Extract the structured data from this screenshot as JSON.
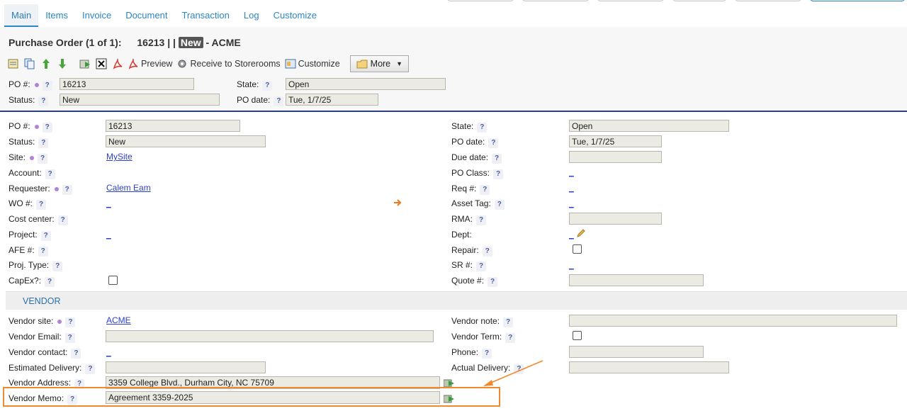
{
  "tabs": [
    {
      "label": "Main",
      "active": true
    },
    {
      "label": "Items"
    },
    {
      "label": "Invoice"
    },
    {
      "label": "Document"
    },
    {
      "label": "Transaction"
    },
    {
      "label": "Log"
    },
    {
      "label": "Customize"
    }
  ],
  "title": {
    "prefix": "Purchase Order (1 of 1):",
    "number": "16213 | |",
    "badge": "New",
    "suffix": "- ACME"
  },
  "toolbar": {
    "preview": "Preview",
    "receive": "Receive to Storerooms",
    "customize": "Customize",
    "more": "More"
  },
  "help": "?",
  "header": {
    "po_label": "PO #:",
    "po_value": "16213",
    "state_label": "State:",
    "state_value": "Open",
    "status_label": "Status:",
    "status_value": "New",
    "po_date_label": "PO date:",
    "po_date_value": "Tue, 1/7/25"
  },
  "left": {
    "po_label": "PO #:",
    "po_value": "16213",
    "status_label": "Status:",
    "status_value": "New",
    "site_label": "Site:",
    "site_value": "MySite",
    "account_label": "Account:",
    "requester_label": "Requester:",
    "requester_value": "Calem Eam",
    "wo_label": "WO #:",
    "wo_value": "_",
    "cost_center_label": "Cost center:",
    "project_label": "Project:",
    "project_value": "_",
    "afe_label": "AFE #:",
    "proj_type_label": "Proj. Type:",
    "capex_label": "CapEx?:"
  },
  "right": {
    "state_label": "State:",
    "state_value": "Open",
    "po_date_label": "PO date:",
    "po_date_value": "Tue, 1/7/25",
    "due_date_label": "Due date:",
    "po_class_label": "PO Class:",
    "po_class_value": "_",
    "req_label": "Req #:",
    "req_value": "_",
    "asset_tag_label": "Asset Tag:",
    "asset_tag_value": "_",
    "rma_label": "RMA:",
    "dept_label": "Dept:",
    "dept_value": "_",
    "repair_label": "Repair:",
    "sr_label": "SR #:",
    "sr_value": "_",
    "quote_label": "Quote #:"
  },
  "vendor": {
    "section_title": "VENDOR",
    "site_label": "Vendor site:",
    "site_value": "ACME",
    "email_label": "Vendor Email:",
    "contact_label": "Vendor contact:",
    "contact_value": "_",
    "est_delivery_label": "Estimated Delivery:",
    "address_label": "Vendor Address:",
    "address_value": "3359 College Blvd., Durham City, NC 75709",
    "memo_label": "Vendor Memo:",
    "memo_value": "Agreement 3359-2025",
    "note_label": "Vendor note:",
    "term_label": "Vendor Term:",
    "phone_label": "Phone:",
    "actual_delivery_label": "Actual Delivery:"
  },
  "colors": {
    "accent": "#2a86c4",
    "highlight": "#f18a2c",
    "divider": "#2c3f80",
    "link": "#2b3fc8"
  }
}
